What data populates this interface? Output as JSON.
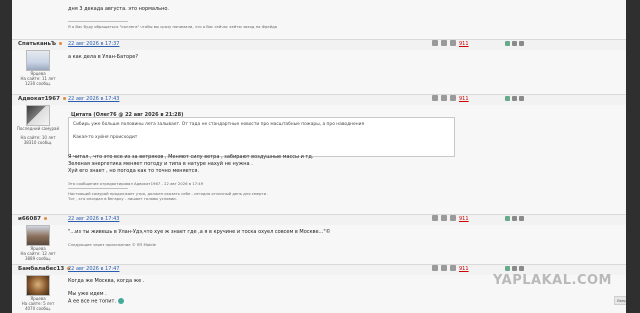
{
  "top_fragment": {
    "line1": "дня 3 декада августа. это нормально.",
    "sig": "Я о Вас буду обращаться \"коллега\" чтобы вы сразу понимали, что я Вас сейчас хейтю заход на Фрейда"
  },
  "posts": [
    {
      "author": "СпатьканьЪ",
      "date": "22 авг 2026 в 17:37",
      "rating": "911",
      "location": "Ярцева",
      "site_time": "На сайте: 11 лет",
      "messages": "1230 сообщ.",
      "text": "а как дела в Улан-Баторе?"
    },
    {
      "author": "Адвокат1967",
      "date": "22 авг 2026 в 17:43",
      "rating": "911",
      "status": "Последний самурай",
      "site_time": "На сайте: 10 лет",
      "messages": "38310 сообщ.",
      "quote_title": "Цитата (Олег76 @ 22 авг 2026 в 21:28)",
      "quote_line1": "Сибирь уже больше половины лета залывает. От тада не стандартные новости про масштабные пожары, а про наводнения",
      "quote_line2": "Какая-то хуйня происходит",
      "text1": "Я читал , что это все из за ветряков , Меняют силу ветра , забирают воздушные массы и тд.",
      "text2": "Зеленая энергетика меняет погоду и типа в натуре нахуй не нужна .",
      "text3": "Хуй его знает , но погода как то точно меняется.",
      "edited": "Это сообщение отредактировал Адвокат1967 - 22 авг 2026 в 17:49",
      "sig1": "Настоящий самурай продолжает утро, должен оказать себе - сегодня отличный день для смерти .",
      "sig2": "Тот , кто опоздал в бегарку - лишает головы условии."
    },
    {
      "author": "и66087",
      "date": "22 авг 2026 в 17:43",
      "rating": "911",
      "location": "Ярцева",
      "site_time": "На сайте: 12 лет",
      "messages": "3889 сообщ.",
      "text": "\"...из ты живешь в Улан-Удэ,что хуе ж знает где ,а я в кручине и тоска охуел совсем в Москве...\"©",
      "attachment": "Следующее через приложение © ЯП Mobile"
    },
    {
      "author": "Бамбалабес13",
      "date": "22 авг 2026 в 17:47",
      "rating": "911",
      "location": "Ярцева",
      "site_time": "На сайте: 5 лет",
      "messages": "4070 сообщ.",
      "text1": "Когда же Москва, когда же .",
      "text2": "Мы уже идем .",
      "text3": "А ее все не топит."
    }
  ],
  "watermark": "YAPLAKAL.COM",
  "scroll_up": "Вверх"
}
